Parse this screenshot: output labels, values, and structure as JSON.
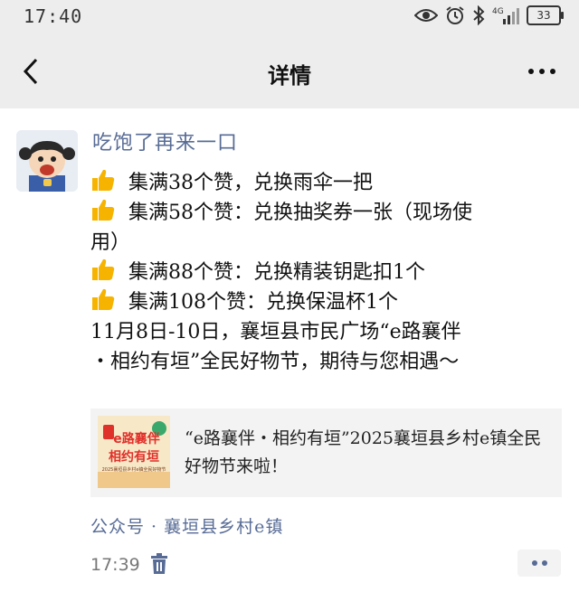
{
  "status_bar": {
    "time": "17:40",
    "network": "4G",
    "battery": "33",
    "icons": [
      "eye-icon",
      "alarm-icon",
      "bluetooth-icon",
      "signal-icon",
      "battery-icon"
    ]
  },
  "nav": {
    "title": "详情",
    "back_icon": "back-arrow-icon",
    "more_icon": "more-dots-icon"
  },
  "post": {
    "author": "吃饱了再来一口",
    "emoji": "thumbs-up",
    "lines": [
      "集满38个赞，兑换雨伞一把",
      "集满58个赞：兑换抽奖券一张（现场使",
      "用）",
      "集满88个赞：兑换精装钥匙扣1个",
      "集满108个赞：兑换保温杯1个",
      "11月8日-10日，襄垣县市民广场“e路襄伴",
      "・相约有垣”全民好物节，期待与您相遇～"
    ],
    "link": {
      "title": "“e路襄伴・相约有垣”2025襄垣县乡村e镇全民好物节来啦！",
      "thumbnail": {
        "line1": "e路襄伴",
        "line2": "相约有垣",
        "line3": "2025襄垣县乡村e镇全民好物节",
        "colors": {
          "background": "#f7e8c8",
          "accent": "#e0302a"
        }
      }
    },
    "source": "公众号 · 襄垣县乡村e镇",
    "time": "17:39"
  },
  "colors": {
    "link_blue": "#576b95",
    "nav_background": "#ededed",
    "card_background": "#f3f3f3",
    "thumb_yellow": "#f6b400"
  }
}
